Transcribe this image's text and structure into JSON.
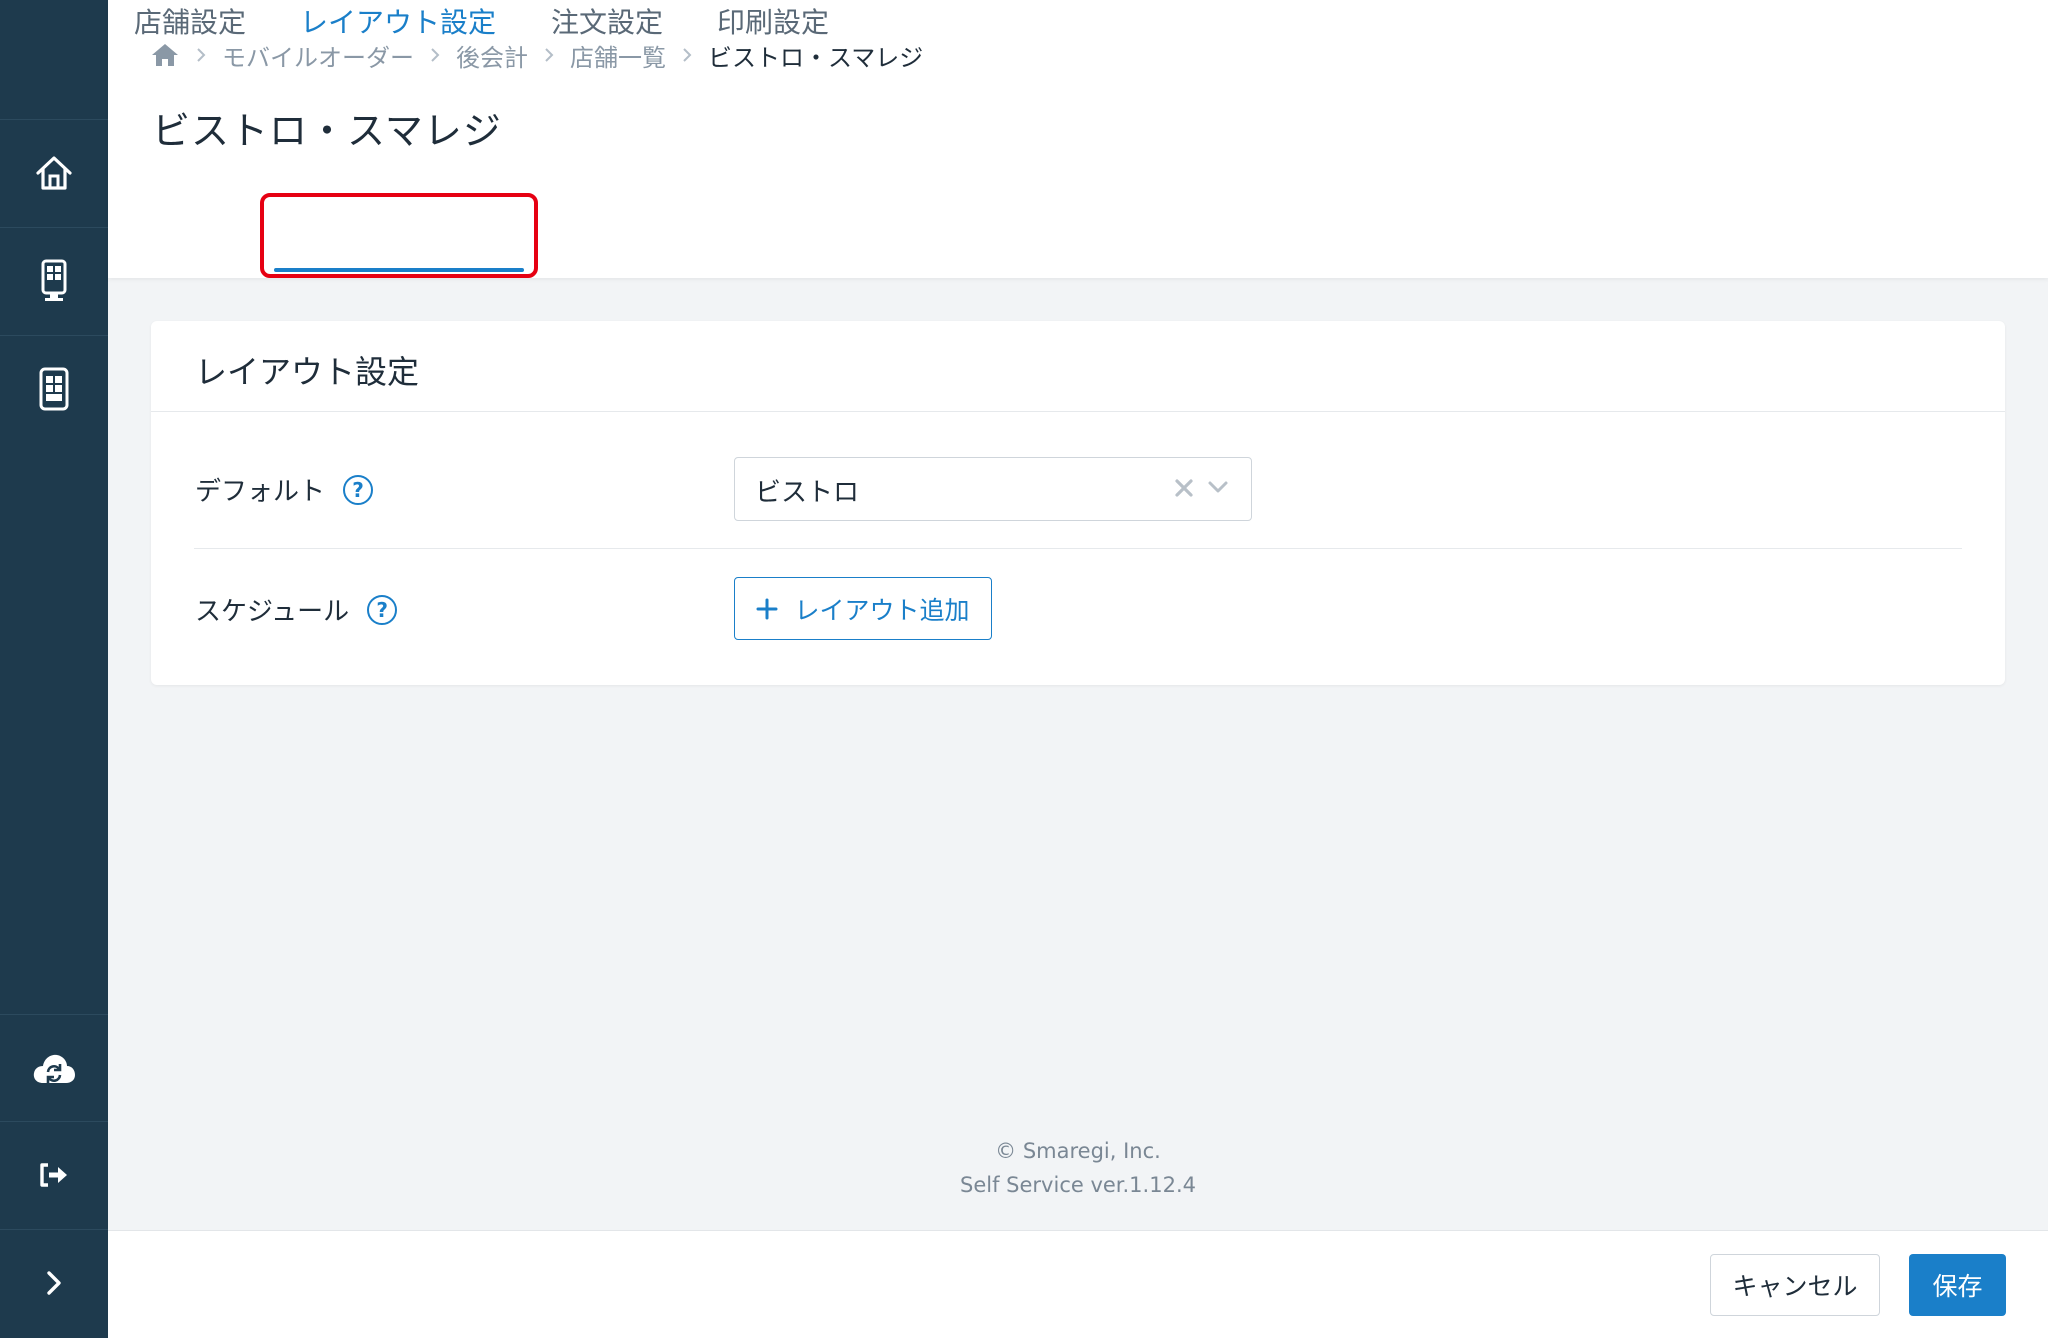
{
  "sidebar": {
    "items": [
      {
        "icon": "home-icon",
        "name": "sidebar-item-home"
      },
      {
        "icon": "kiosk-icon",
        "name": "sidebar-item-kiosk"
      },
      {
        "icon": "tablet-icon",
        "name": "sidebar-item-tablet"
      },
      {
        "icon": "cloud-sync-icon",
        "name": "sidebar-item-sync"
      },
      {
        "icon": "logout-icon",
        "name": "sidebar-item-logout"
      },
      {
        "icon": "chevron-right-icon",
        "name": "sidebar-expand"
      }
    ]
  },
  "breadcrumb": {
    "items": [
      "モバイルオーダー",
      "後会計",
      "店舗一覧"
    ],
    "current": "ビストロ・スマレジ"
  },
  "page": {
    "title": "ビストロ・スマレジ"
  },
  "tabs": [
    {
      "label": "店舗設定"
    },
    {
      "label": "レイアウト設定",
      "active": true
    },
    {
      "label": "注文設定"
    },
    {
      "label": "印刷設定"
    }
  ],
  "card": {
    "title": "レイアウト設定",
    "default_label": "デフォルト",
    "default_value": "ビストロ",
    "schedule_label": "スケジュール",
    "add_layout_label": "レイアウト追加",
    "help_glyph": "?"
  },
  "footer": {
    "copyright": "© Smaregi, Inc.",
    "version": "Self Service ver.1.12.4"
  },
  "actions": {
    "cancel_label": "キャンセル",
    "save_label": "保存"
  },
  "colors": {
    "sidebar": "#1e3a4d",
    "accent": "#1a7fc9",
    "highlight": "#e60012"
  }
}
